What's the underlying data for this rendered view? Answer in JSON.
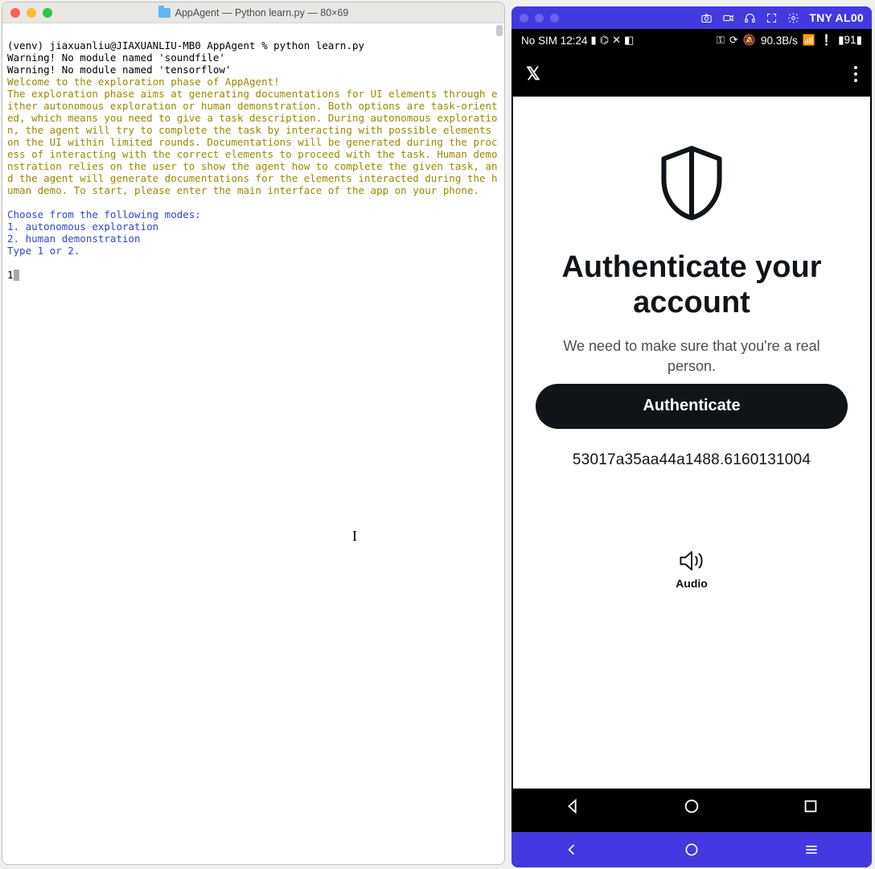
{
  "mac": {
    "title": "AppAgent — Python learn.py — 80×69"
  },
  "terminal": {
    "prompt": "(venv) jiaxuanliu@JIAXUANLIU-MB0 AppAgent % python learn.py",
    "warn1": "Warning! No module named 'soundfile'",
    "warn2": "Warning! No module named 'tensorflow'",
    "welcome": "Welcome to the exploration phase of AppAgent!",
    "desc": "The exploration phase aims at generating documentations for UI elements through either autonomous exploration or human demonstration. Both options are task-oriented, which means you need to give a task description. During autonomous exploration, the agent will try to complete the task by interacting with possible elements on the UI within limited rounds. Documentations will be generated during the process of interacting with the correct elements to proceed with the task. Human demonstration relies on the user to show the agent how to complete the given task, and the agent will generate documentations for the elements interacted during the human demo. To start, please enter the main interface of the app on your phone.",
    "choose": "Choose from the following modes:",
    "mode1": "1. autonomous exploration",
    "mode2": "2. human demonstration",
    "type12": "Type 1 or 2.",
    "input": "1"
  },
  "scrcpy": {
    "device": "TNY AL00"
  },
  "status": {
    "left": "No SIM 12:24",
    "net": "90.3B/s",
    "batt": "91"
  },
  "app": {
    "title": "Authenticate your account",
    "sub": "We need to make sure that you're a real person.",
    "btn": "Authenticate",
    "code": "53017a35aa44a1488.6160131004",
    "audio": "Audio"
  }
}
